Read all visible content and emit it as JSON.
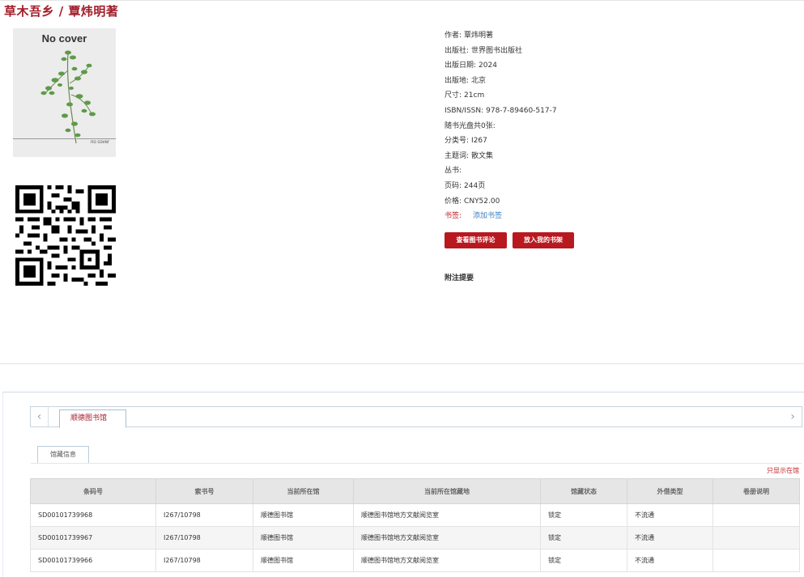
{
  "page_title": "草木吾乡 / 覃炜明著",
  "cover": {
    "label": "No cover",
    "small_label": "no cover"
  },
  "meta": [
    {
      "label": "作者:",
      "value": "覃炜明著"
    },
    {
      "label": "出版社:",
      "value": "世界图书出版社"
    },
    {
      "label": "出版日期:",
      "value": "2024"
    },
    {
      "label": "出版地:",
      "value": "北京"
    },
    {
      "label": "尺寸:",
      "value": "21cm"
    },
    {
      "label": "ISBN/ISSN:",
      "value": "978-7-89460-517-7"
    },
    {
      "label": "随书光盘共0张:",
      "value": ""
    },
    {
      "label": "分类号:",
      "value": "I267"
    },
    {
      "label": "主题词:",
      "value": "散文集"
    },
    {
      "label": "丛书:",
      "value": ""
    },
    {
      "label": "页码:",
      "value": "244页"
    },
    {
      "label": "价格:",
      "value": "CNY52.00"
    }
  ],
  "bookmark": {
    "label": "书签:",
    "link": "添加书签"
  },
  "buttons": {
    "review": "查看图书评论",
    "shelf": "放入我的书架"
  },
  "annotation_label": "附注提要",
  "library_tab": {
    "label": "顺德图书馆",
    "prev": "‹",
    "next": "›"
  },
  "holdings_tab": "馆藏信息",
  "only_show_link": "只显示在馆",
  "table": {
    "headers": [
      "条码号",
      "索书号",
      "当前所在馆",
      "当前所在馆藏地",
      "馆藏状态",
      "外借类型",
      "卷册说明"
    ],
    "rows": [
      [
        "SD00101739968",
        "I267/10798",
        "顺德图书馆",
        "顺德图书馆地方文献阅览室",
        "锁定",
        "不流通",
        ""
      ],
      [
        "SD00101739967",
        "I267/10798",
        "顺德图书馆",
        "顺德图书馆地方文献阅览室",
        "锁定",
        "不流通",
        ""
      ],
      [
        "SD00101739966",
        "I267/10798",
        "顺德图书馆",
        "顺德图书馆地方文献阅览室",
        "锁定",
        "不流通",
        ""
      ]
    ]
  },
  "colors": {
    "accent": "#a31d2a",
    "button": "#b8191f",
    "link": "#3d7fc1"
  }
}
